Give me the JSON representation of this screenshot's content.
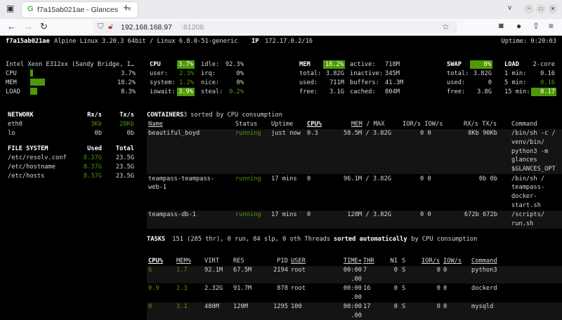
{
  "browser": {
    "tab_title": "f7a15ab021ae - Glances",
    "url_host": "192.168.168.97",
    "url_port": ":61208",
    "new_tab": "+",
    "close_tab": "×"
  },
  "header": {
    "hostname": "f7a15ab021ae",
    "os": "Alpine Linux 3.20.3 64bit / Linux 6.8.0-51-generic",
    "ip_label": "IP",
    "ip": "172.17.0.2/16",
    "uptime": "Uptime: 0:20:03"
  },
  "quicklook": {
    "cpu_name": "Intel Xeon E312xx (Sandy Bridge, I…",
    "rows": [
      {
        "label": "CPU",
        "value": "3.7%",
        "pct": 3.7
      },
      {
        "label": "MEM",
        "value": "18.2%",
        "pct": 18.2
      },
      {
        "label": "LOAD",
        "value": "8.3%",
        "pct": 8.3
      }
    ]
  },
  "cpu": {
    "title": "CPU",
    "total": "3.7%",
    "user_l": "user:",
    "user": "2.3%",
    "system_l": "system:",
    "system": "1.2%",
    "iowait_l": "iowait:",
    "iowait": "3.9%",
    "idle_l": "idle:",
    "idle": "92.3%",
    "irq_l": "irq:",
    "irq": "0%",
    "nice_l": "nice:",
    "nice": "0%",
    "steal_l": "steal:",
    "steal": "0.2%"
  },
  "mem": {
    "title": "MEM",
    "total_pct": "18.2%",
    "total_l": "total:",
    "total": "3.82G",
    "used_l": "used:",
    "used": "711M",
    "free_l": "free:",
    "free": "3.1G",
    "active_l": "active:",
    "active": "718M",
    "inactive_l": "inactive:",
    "inactive": "345M",
    "buffers_l": "buffers:",
    "buffers": "41.3M",
    "cached_l": "cached:",
    "cached": "804M"
  },
  "swap": {
    "title": "SWAP",
    "pct": "0%",
    "total_l": "total:",
    "total": "3.82G",
    "used_l": "used:",
    "used": "0",
    "free_l": "free:",
    "free": "3.8G"
  },
  "load": {
    "title": "LOAD",
    "cores": "2-core",
    "m1_l": "1 min:",
    "m1": "0.16",
    "m5_l": "5 min:",
    "m5": "0.16",
    "m15_l": "15 min:",
    "m15": "0.17"
  },
  "network": {
    "title": "NETWORK",
    "rx": "Rx/s",
    "tx": "Tx/s",
    "rows": [
      {
        "name": "eth0",
        "rx": "3Kb",
        "tx": "28Kb"
      },
      {
        "name": "lo",
        "rx": "0b",
        "tx": "0b"
      }
    ]
  },
  "fs": {
    "title": "FILE SYSTEM",
    "used": "Used",
    "total": "Total",
    "rows": [
      {
        "name": "/etc/resolv.conf",
        "used": "8.37G",
        "total": "23.5G"
      },
      {
        "name": "/etc/hostname",
        "used": "8.37G",
        "total": "23.5G"
      },
      {
        "name": "/etc/hosts",
        "used": "8.37G",
        "total": "23.5G"
      }
    ]
  },
  "containers": {
    "title": "CONTAINERS",
    "count": "3",
    "sort": " sorted by CPU consumption",
    "cols": {
      "name": "Name",
      "status": "Status",
      "uptime": "Uptime",
      "cpu": "CPU%",
      "mem": "MEM",
      "max": " / MAX",
      "io": "IOR/s IOW/s",
      "net": "RX/s TX/s",
      "cmd": "Command"
    },
    "rows": [
      {
        "name": [
          "beautiful_boyd"
        ],
        "status": "running",
        "uptime": "just now",
        "cpu": "0.3",
        "mem": "58.5M / 3.82G",
        "io": "0 0",
        "net": "8Kb 90Kb",
        "cmd": [
          "/bin/sh -c /",
          "venv/bin/",
          "python3 -m",
          "glances",
          "$GLANCES_OPT"
        ]
      },
      {
        "name": [
          "teampass-teampass-",
          "web-1"
        ],
        "status": "running",
        "uptime": "17 mins",
        "cpu": "0",
        "mem": "96.1M / 3.82G",
        "io": "0 0",
        "net": "0b 0b",
        "cmd": [
          "/bin/sh /",
          "teampass-",
          "docker-",
          "start.sh"
        ]
      },
      {
        "name": [
          "teampass-db-1"
        ],
        "status": "running",
        "uptime": "17 mins",
        "cpu": "0",
        "mem": "128M / 3.82G",
        "io": "0 0",
        "net": "672b 672b",
        "cmd": [
          "/scripts/",
          "run.sh"
        ]
      }
    ]
  },
  "tasks": {
    "title": "TASKS",
    "summary": " 151 (285 thr), 0 run, 84 slp, 0 oth Threads ",
    "sorted": "sorted automatically",
    "by": " by CPU consumption"
  },
  "processes": {
    "cols": {
      "cpu": "CPU%",
      "mem": "MEM%",
      "virt": "VIRT",
      "res": "RES",
      "pid": "PID",
      "user": "USER",
      "time": "TIME+",
      "thr": "THR",
      "ni": "NI",
      "s": "S",
      "ior": "IOR/s",
      "iow": "IOW/s",
      "cmd": "Command"
    },
    "rows": [
      {
        "cpu": "6",
        "mem": "1.7",
        "virt": "92.1M",
        "res": "67.5M",
        "pid": "2194",
        "user": "root",
        "time": "00:00",
        "time2": ".00",
        "thr": "7",
        "ni": "0",
        "s": "S",
        "ior": "0",
        "iow": "0",
        "cmd": "python3"
      },
      {
        "cpu": "0.9",
        "mem": "2.3",
        "virt": "2.32G",
        "res": "91.7M",
        "pid": "878",
        "user": "root",
        "time": "00:00",
        "time2": ".00",
        "thr": "16",
        "ni": "0",
        "s": "S",
        "ior": "0",
        "iow": "0",
        "cmd": "dockerd"
      },
      {
        "cpu": "0",
        "mem": "3.1",
        "virt": "480M",
        "res": "120M",
        "pid": "1295",
        "user": "100",
        "time": "00:00",
        "time2": ".00",
        "thr": "17",
        "ni": "0",
        "s": "S",
        "ior": "0",
        "iow": "0",
        "cmd": "mysqld"
      }
    ]
  }
}
